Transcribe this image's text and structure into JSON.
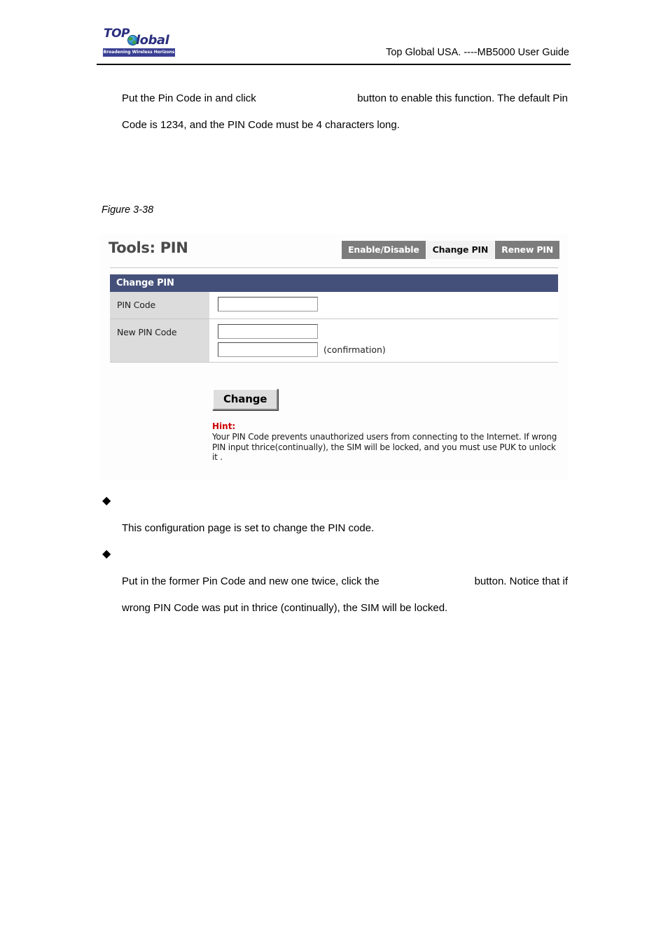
{
  "document": {
    "header": {
      "logo": {
        "word_top": "TOP",
        "word_global": "lobal",
        "globe_icon": "globe-icon",
        "tagline": "Broadening Wireless Horizons"
      },
      "title": "Top Global USA. ----MB5000 User Guide"
    },
    "intro_paragraph": {
      "line1_before_button": "Put the Pin Code in and click",
      "line1_after_button": "button to enable this function. The default Pin",
      "line2": "Code is 1234, and the PIN Code must be 4 characters long."
    },
    "figure_caption": "Figure 3-38",
    "bullets": [
      {
        "marker": "◆",
        "body": "This configuration page is set to change the PIN code."
      },
      {
        "marker": "◆",
        "body_line1_before_button": "Put in the former Pin Code and new one twice, click the",
        "body_line1_after_button": "button. Notice that if",
        "body_line2": "wrong PIN Code was put in thrice (continually), the SIM will be locked."
      }
    ]
  },
  "figure": {
    "app_title": "Tools: PIN",
    "tabs": [
      {
        "label": "Enable/Disable",
        "active": false
      },
      {
        "label": "Change PIN",
        "active": true
      },
      {
        "label": "Renew PIN",
        "active": false
      }
    ],
    "panel": {
      "header": "Change PIN",
      "rows": [
        {
          "label": "PIN Code",
          "fields": [
            {
              "value": "",
              "placeholder": "",
              "note": ""
            }
          ]
        },
        {
          "label": "New PIN Code",
          "fields": [
            {
              "value": "",
              "placeholder": "",
              "note": ""
            },
            {
              "value": "",
              "placeholder": "",
              "note": "(confirmation)"
            }
          ]
        }
      ]
    },
    "submit_button": "Change",
    "hint": {
      "title": "Hint:",
      "body": "Your PIN Code prevents unauthorized users from connecting to the Internet. If wrong PIN input thrice(continually), the SIM will be locked, and you must use PUK to unlock it ."
    },
    "colors": {
      "panel_header_bg": "#44507a",
      "tab_inactive_bg": "#7c7c7c",
      "tab_active_bg": "#f2f2f2",
      "row_label_bg": "#dcdcdc",
      "hint_title": "#cc0000",
      "app_title": "#4a4a4a"
    }
  }
}
